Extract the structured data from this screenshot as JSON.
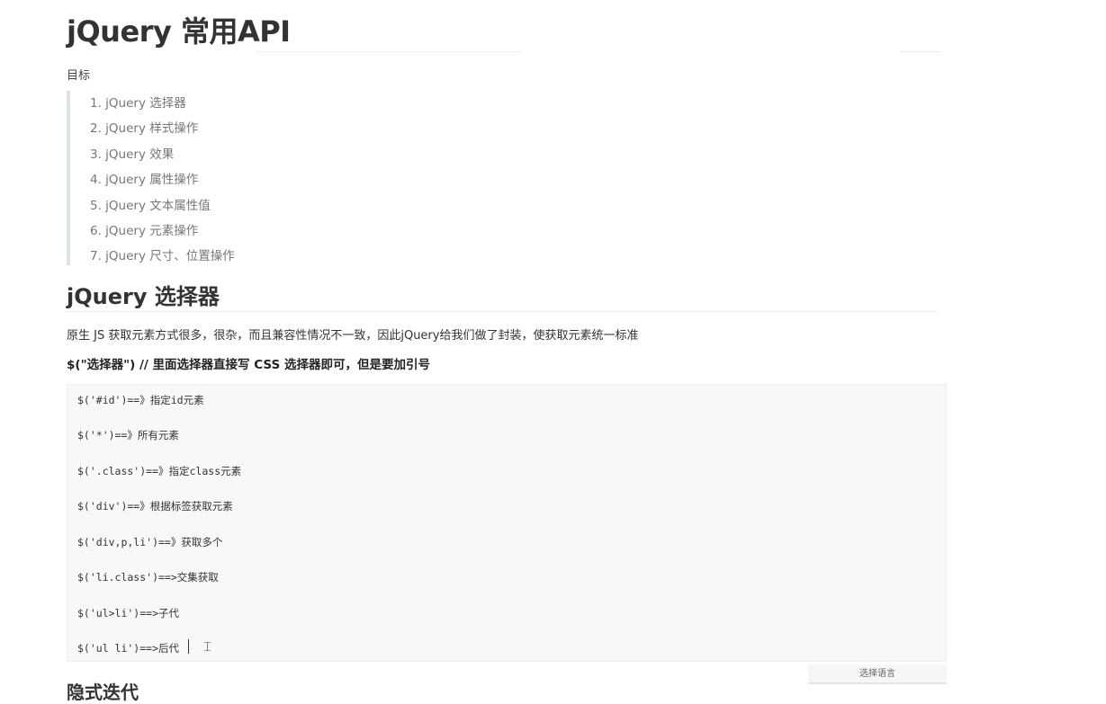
{
  "title": "jQuery 常用API",
  "goal_label": "目标",
  "toc": [
    "1. jQuery 选择器",
    "2. jQuery 样式操作",
    "3. jQuery 效果",
    "4. jQuery 属性操作",
    "5. jQuery 文本属性值",
    "6. jQuery 元素操作",
    "7. jQuery 尺寸、位置操作"
  ],
  "section": {
    "heading": "jQuery 选择器",
    "description": "原生 JS 获取元素方式很多，很杂，而且兼容性情况不一致，因此jQuery给我们做了封装，使获取元素统一标准",
    "bold_note": "$(\"选择器\")   // 里面选择器直接写 CSS 选择器即可，但是要加引号",
    "code_lines": [
      "$('#id')==》指定id元素",
      "$('*')==》所有元素",
      "$('.class')==》指定class元素",
      "$('div')==》根据标签获取元素",
      "$('div,p,li')==》获取多个",
      "$('li.class')==>交集获取",
      "$('ul>li')==>子代",
      "$('ul li')==>后代"
    ],
    "language_select": "选择语言"
  },
  "next_heading": "隐式迭代"
}
